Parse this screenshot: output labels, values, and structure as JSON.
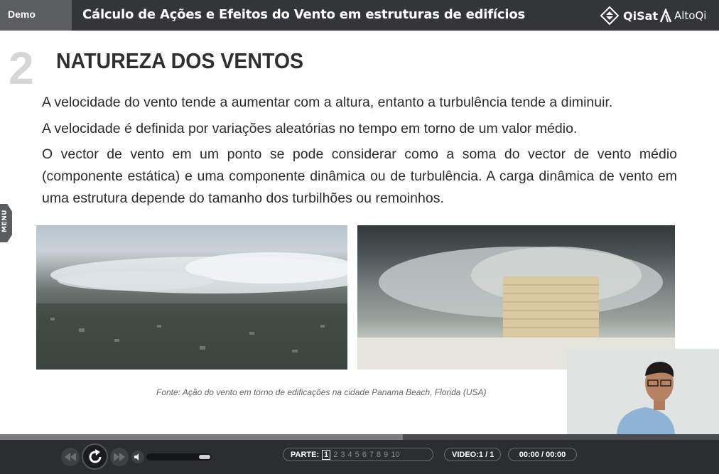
{
  "header": {
    "demo_label": "Demo",
    "title": "Cálculo de Ações e Efeitos do Vento em estruturas de edifícios",
    "logo_qisat": "QiSat",
    "logo_altoqi": "AltoQi",
    "bg_color": "#333538"
  },
  "slide": {
    "section_number": "2",
    "section_title": "NATUREZA DOS VENTOS",
    "paragraphs": [
      "A velocidade do vento tende a aumentar com a altura, entanto a turbulência tende a diminuir.",
      "A velocidade é definida por variações aleatórias no tempo em torno de um valor médio.",
      "O vector de vento em um ponto se pode considerar como a soma do vector de vento médio (componente estática) e uma componente dinâmica ou de turbulência. A carga dinâmica de vento em uma estrutura depende do tamanho dos turbilhões ou remoinhos."
    ],
    "caption": "Fonte: Ação do vento em torno de edificações na cidade Panama Beach, Florida (USA)"
  },
  "side_menu": {
    "label": "MENU"
  },
  "player": {
    "progress_fraction": 0.56,
    "volume_fraction": 0.85,
    "parts_label": "PARTE:",
    "parts": [
      "1",
      "2",
      "3",
      "4",
      "5",
      "6",
      "7",
      "8",
      "9",
      "10"
    ],
    "active_part": "1",
    "video_label": "VIDEO:",
    "video_value": "1 / 1",
    "time_value": "00:00 / 00:00",
    "icons": [
      "rewind-icon",
      "replay-icon",
      "fast-forward-icon",
      "volume-icon"
    ]
  }
}
